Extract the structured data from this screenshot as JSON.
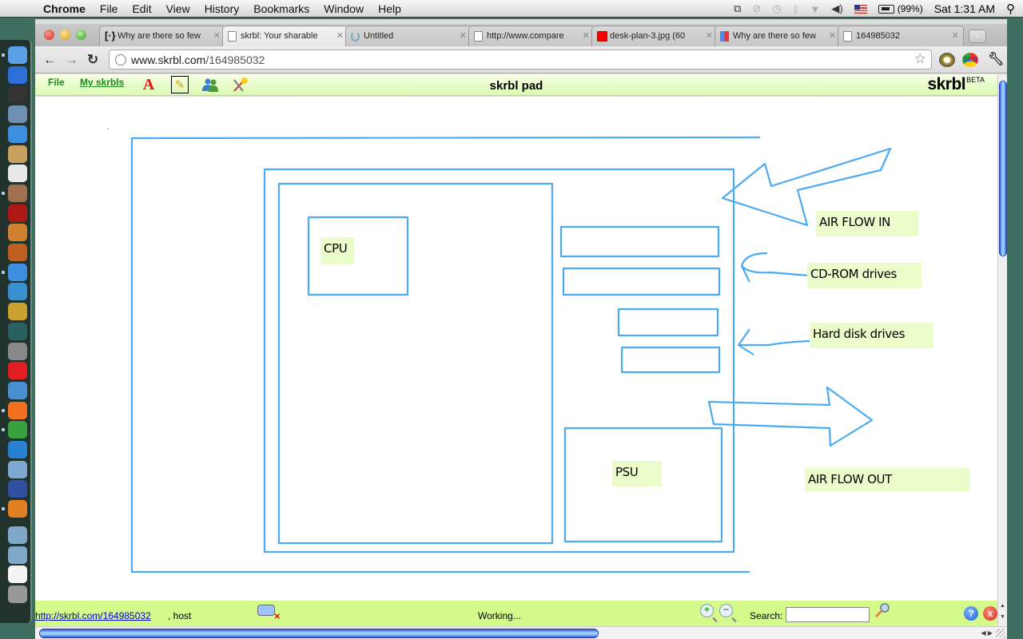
{
  "menubar": {
    "app_name": "Chrome",
    "menus": [
      "File",
      "Edit",
      "View",
      "History",
      "Bookmarks",
      "Window",
      "Help"
    ],
    "battery": "(99%)",
    "clock": "Sat 1:31 AM",
    "status_icons": [
      "window-icon",
      "link-icon",
      "time-machine-icon",
      "bluetooth-icon",
      "wifi-icon",
      "volume-icon",
      "us-flag-icon",
      "battery-icon",
      "spotlight-icon"
    ]
  },
  "dock": {
    "apps": [
      "Finder",
      "App Store",
      "Dashboard",
      "Mail",
      "FaceTime",
      "Address Book",
      "iCal",
      "iPhoto",
      "Front Row",
      "Photo Booth",
      "GarageBand",
      "Xcode",
      "iChat",
      "iMovie",
      "Time Machine",
      "System Preferences",
      "VNC",
      "Safari",
      "Firefox",
      "Chrome",
      "OpenOffice",
      "Virtual Box",
      "Remote Desktop",
      "Keychain Access",
      "Applications",
      "Documents",
      "Document",
      "Trash"
    ]
  },
  "browser": {
    "tabs": [
      {
        "title": "Why are there so few",
        "favicon": "bracket",
        "active": false
      },
      {
        "title": "skrbl: Your sharable",
        "favicon": "page",
        "active": true
      },
      {
        "title": "Untitled",
        "favicon": "loading",
        "active": false
      },
      {
        "title": "http://www.compare",
        "favicon": "page",
        "active": false
      },
      {
        "title": "desk-plan-3.jpg (60",
        "favicon": "red",
        "active": false
      },
      {
        "title": "Why are there so few",
        "favicon": "google",
        "active": false
      },
      {
        "title": "164985032",
        "favicon": "page",
        "active": false
      }
    ],
    "new_tab_label": "+",
    "url_host": "www.skrbl.com",
    "url_path": "/164985032"
  },
  "app": {
    "menu_file": "File",
    "menu_my_skrbls": "My skrbls",
    "pad_title": "skrbl pad",
    "logo": "skrbl",
    "logo_badge": "BETA",
    "tools": [
      "text-tool",
      "pencil-tool",
      "users-tool",
      "pin-tool"
    ],
    "selected_tool": "pencil-tool",
    "stroke_color": "#4daaf0",
    "note_color": "#ebfccb"
  },
  "canvas": {
    "notes": [
      {
        "text": "CPU"
      },
      {
        "text": "AIR FLOW IN"
      },
      {
        "text": "CD-ROM drives"
      },
      {
        "text": "Hard disk drives"
      },
      {
        "text": "PSU"
      },
      {
        "text": "AIR FLOW OUT"
      }
    ]
  },
  "statusbar": {
    "link": "http://skrbl.com/164985032",
    "host": ", host",
    "status": "Working...",
    "zoom_in": "+",
    "zoom_out": "−",
    "search_label": "Search:",
    "search_value": "",
    "help_label": "?",
    "close_label": "x"
  }
}
